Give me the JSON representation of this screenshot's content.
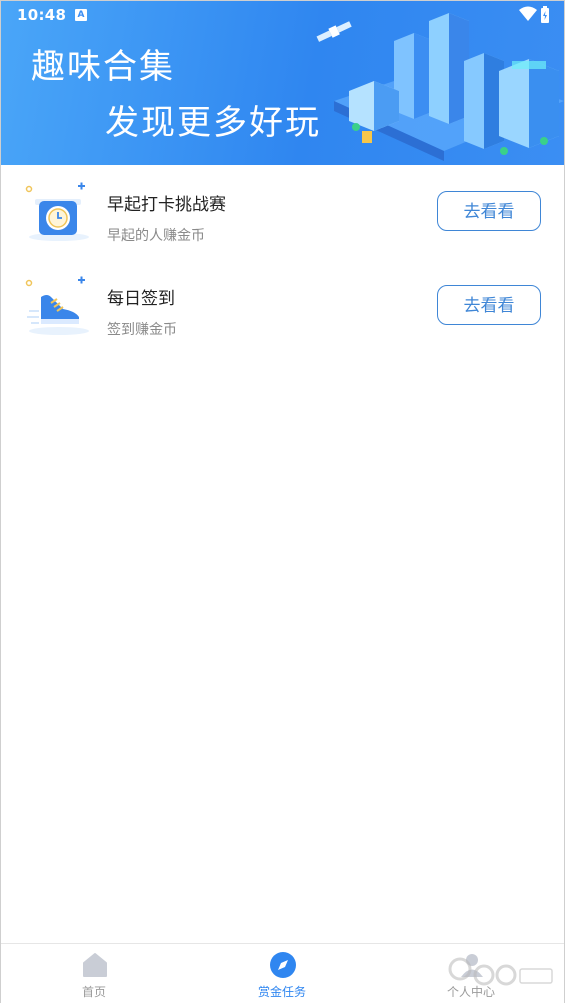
{
  "status": {
    "time": "10:48",
    "notif_badge": "A"
  },
  "banner": {
    "title": "趣味合集",
    "subtitle": "发现更多好玩"
  },
  "tasks": [
    {
      "title": "早起打卡挑战赛",
      "desc": "早起的人赚金币",
      "button": "去看看",
      "icon": "alarm-clock-icon"
    },
    {
      "title": "每日签到",
      "desc": "签到赚金币",
      "button": "去看看",
      "icon": "sneaker-icon"
    }
  ],
  "tabs": [
    {
      "label": "首页",
      "icon": "home-icon",
      "active": false
    },
    {
      "label": "赏金任务",
      "icon": "compass-icon",
      "active": true
    },
    {
      "label": "个人中心",
      "icon": "person-icon",
      "active": false
    }
  ],
  "colors": {
    "accent": "#2f86f0",
    "button_border": "#3f86d6"
  }
}
